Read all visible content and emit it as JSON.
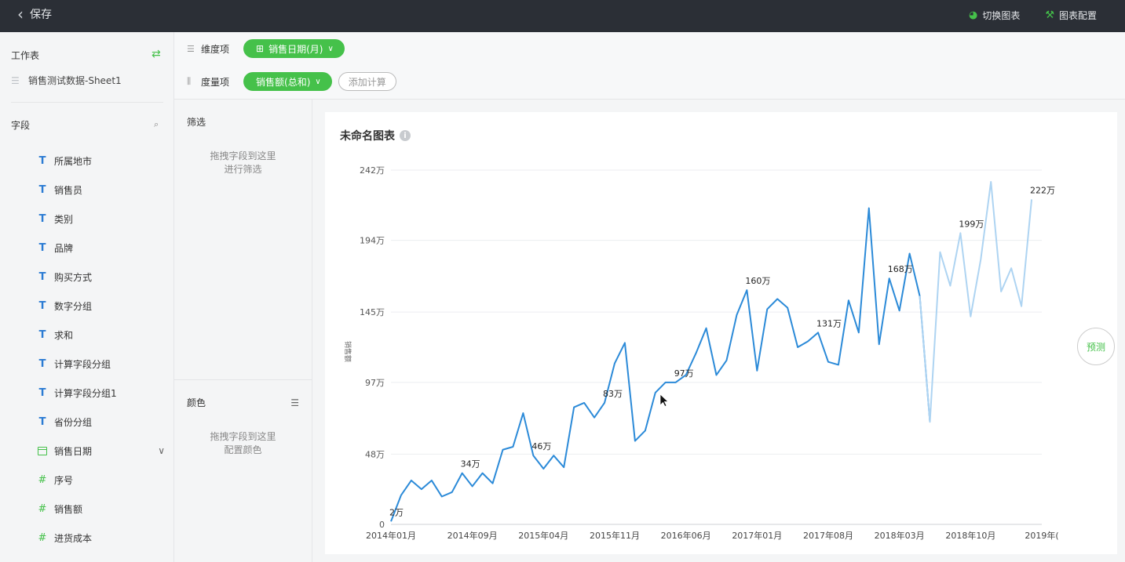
{
  "topbar": {
    "back_label": "保存",
    "switch_chart_label": "切换图表",
    "chart_config_label": "图表配置"
  },
  "left": {
    "worksheet_title": "工作表",
    "sheet_name": "销售测试数据-Sheet1",
    "fields_title": "字段",
    "fields": [
      {
        "type": "text",
        "label": "所属地市"
      },
      {
        "type": "text",
        "label": "销售员"
      },
      {
        "type": "text",
        "label": "类别"
      },
      {
        "type": "text",
        "label": "品牌"
      },
      {
        "type": "text",
        "label": "购买方式"
      },
      {
        "type": "text",
        "label": "数字分组"
      },
      {
        "type": "text",
        "label": "求和"
      },
      {
        "type": "text",
        "label": "计算字段分组"
      },
      {
        "type": "text",
        "label": "计算字段分组1"
      },
      {
        "type": "text",
        "label": "省份分组"
      },
      {
        "type": "date",
        "label": "销售日期"
      },
      {
        "type": "number",
        "label": "序号"
      },
      {
        "type": "number",
        "label": "销售额"
      },
      {
        "type": "number",
        "label": "进货成本"
      }
    ]
  },
  "dims": {
    "dimension_label": "维度项",
    "dimension_pill": "销售日期(月)",
    "measure_label": "度量项",
    "measure_pill": "销售额(总和)",
    "add_calc_label": "添加计算"
  },
  "filter": {
    "title": "筛选",
    "hint_line1": "拖拽字段到这里",
    "hint_line2": "进行筛选",
    "color_title": "颜色",
    "color_hint_line1": "拖拽字段到这里",
    "color_hint_line2": "配置颜色"
  },
  "chart": {
    "title": "未命名图表",
    "forecast_label": "预测",
    "accent": "#45c14a",
    "line_color": "#2b8ad8",
    "forecast_color": "#aed4f2"
  },
  "chart_data": {
    "type": "line",
    "title": "未命名图表",
    "ylabel": "销售额",
    "ylim": [
      0,
      242
    ],
    "y_ticks": [
      "0",
      "48万",
      "97万",
      "145万",
      "194万",
      "242万"
    ],
    "y_tick_values": [
      0,
      48,
      97,
      145,
      194,
      242
    ],
    "x_tick_labels": [
      "2014年01月",
      "2014年09月",
      "2015年04月",
      "2015年11月",
      "2016年06月",
      "2017年01月",
      "2017年08月",
      "2018年03月",
      "2018年10月",
      "2019年("
    ],
    "x_tick_index": [
      0,
      8,
      15,
      22,
      29,
      36,
      43,
      50,
      57,
      64
    ],
    "grid": true,
    "series": [
      {
        "name": "销售额",
        "values": [
          2,
          20,
          30,
          24,
          30,
          19,
          22,
          35,
          26,
          35,
          28,
          51,
          53,
          76,
          47,
          38,
          47,
          39,
          80,
          83,
          73,
          83,
          110,
          124,
          57,
          64,
          90,
          97,
          97,
          102,
          117,
          134,
          102,
          112,
          143,
          160,
          105,
          147,
          154,
          148,
          121,
          125,
          131,
          111,
          109,
          153,
          131,
          216,
          123,
          168,
          146,
          185,
          156,
          70
        ]
      },
      {
        "name": "预测",
        "values": [
          156,
          70,
          186,
          163,
          199,
          142,
          181,
          234,
          159,
          175,
          149,
          222
        ]
      }
    ],
    "data_labels": [
      {
        "x": "2014年01月",
        "index": 0,
        "text": "2万"
      },
      {
        "x": "2014年09月",
        "index": 7,
        "text": "34万"
      },
      {
        "x": "2015年03月",
        "index": 14,
        "text": "46万"
      },
      {
        "x": "2015年10月",
        "index": 21,
        "text": "83万"
      },
      {
        "x": "2016年05月",
        "index": 28,
        "text": "97万"
      },
      {
        "x": "2016年12月",
        "index": 35,
        "text": "160万"
      },
      {
        "x": "2017年07月",
        "index": 42,
        "text": "131万"
      },
      {
        "x": "2018年02月",
        "index": 49,
        "text": "168万"
      },
      {
        "x": "2018年09月",
        "index": 56,
        "text": "199万"
      },
      {
        "x": "2019年",
        "index": 63,
        "text": "222万"
      }
    ]
  }
}
